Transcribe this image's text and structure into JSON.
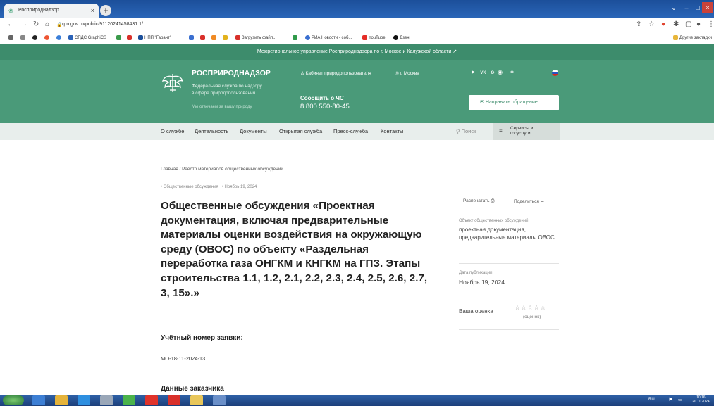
{
  "browser": {
    "tab_title": "Росприроднадзор |",
    "tab_close": "×",
    "new_tab": "+",
    "url": "rpn.gov.ru/public/91120241458431 1/",
    "bookmarks": [
      {
        "label": "СПДС GraphiCS",
        "color": "#2a62b7"
      },
      {
        "label": "НПП \"Гарант\"",
        "color": "#1b4f9a"
      },
      {
        "label": "Загрузить файл...",
        "color": "#d8302a"
      },
      {
        "label": "РИА Новости - соб...",
        "color": "#3a6fd0"
      },
      {
        "label": "YouTube",
        "color": "#e52d27"
      },
      {
        "label": "Дзен",
        "color": "#111111"
      }
    ],
    "other_bookmarks": "Другие закладки"
  },
  "site": {
    "top_banner": "Межрегиональное управление Росприроднадзора по г. Москве и Калужской области ↗",
    "brand_name": "РОСПРИРОДНАДЗОР",
    "brand_sub1": "Федеральная служба по надзору",
    "brand_sub2": "в сфере природопользования",
    "brand_slogan": "Мы отвечаем за вашу природу",
    "cabinet_link": "Кабинет природопользователя",
    "city": "г. Москва",
    "report_label": "Сообщить о ЧС",
    "phone": "8 800 550-80-45",
    "appeal_button": "Направить обращение",
    "menu": [
      "О службе",
      "Деятельность",
      "Документы",
      "Открытая служба",
      "Пресс-служба",
      "Контакты"
    ],
    "search_label": "Поиск",
    "services_line1": "Сервисы и",
    "services_line2": "госуслуги"
  },
  "article": {
    "breadcrumb": "Главная / Реестр материалов общественных обсуждений",
    "tag": "• Общественные обсуждения",
    "date_tag": "• Ноябрь 19, 2024",
    "title": "Общественные обсуждения «Проектная документация, включая предварительные материалы оценки воздействия на окружающую среду (ОВОС) по объекту «Раздельная переработка газа ОНГКМ и КНГКМ на ГПЗ. Этапы строительства 1.1, 1.2, 2.1, 2.2, 2.3, 2.4, 2.5, 2.6, 2.7, 3, 15».»",
    "req_number_label": "Учётный номер заявки:",
    "req_number_value": "МО-18-11-2024-13",
    "customer_label": "Данные заказчика"
  },
  "sidebar": {
    "print_label": "Распечатать",
    "share_label": "Поделиться",
    "object_label": "Объект общественных обсуждений:",
    "object_value": "проектная документация, предварительные материалы ОВОС",
    "pub_date_label": "Дата публикации:",
    "pub_date_value": "Ноябрь 19, 2024",
    "rating_label": "Ваша оценка",
    "rating_count": "(оценок)",
    "rating_stars": 0
  },
  "taskbar": {
    "lang": "RU",
    "clock_time": "10:16",
    "clock_date": "20.11.2024"
  }
}
